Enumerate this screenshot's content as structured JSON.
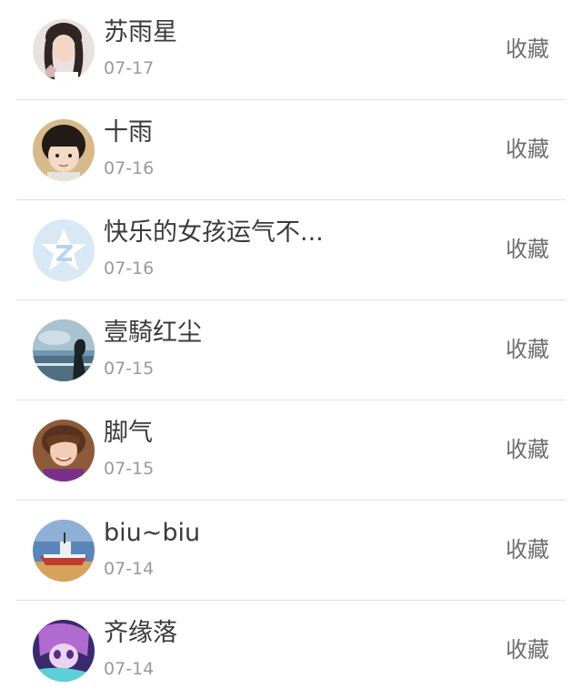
{
  "items": [
    {
      "name": "苏雨星",
      "date": "07-17",
      "action": "收藏",
      "avatar_icon": "girl-portrait-avatar",
      "avatar_colors": [
        "#e9e1df",
        "#2f2523",
        "#f3d6c8"
      ]
    },
    {
      "name": "十雨",
      "date": "07-16",
      "action": "收藏",
      "avatar_icon": "child-portrait-avatar",
      "avatar_colors": [
        "#d7b98c",
        "#231b16",
        "#f4d9c6"
      ]
    },
    {
      "name": "快乐的女孩运气不...",
      "date": "07-16",
      "action": "收藏",
      "avatar_icon": "qzone-default-avatar",
      "avatar_colors": [
        "#d8e9f5",
        "#ffffff",
        "#b8d4ea"
      ]
    },
    {
      "name": "壹騎红尘",
      "date": "07-15",
      "action": "收藏",
      "avatar_icon": "silhouette-sea-avatar",
      "avatar_colors": [
        "#6f97b2",
        "#1b2328",
        "#a9c2cf"
      ]
    },
    {
      "name": "脚气",
      "date": "07-15",
      "action": "收藏",
      "avatar_icon": "boy-portrait-avatar",
      "avatar_colors": [
        "#8d5a3a",
        "#f3cdb5",
        "#7b2f8a"
      ]
    },
    {
      "name": "biu~biu",
      "date": "07-14",
      "action": "收藏",
      "avatar_icon": "boat-beach-avatar",
      "avatar_colors": [
        "#5b86b8",
        "#c33a2e",
        "#d8a25a"
      ]
    },
    {
      "name": "齐缘落",
      "date": "07-14",
      "action": "收藏",
      "avatar_icon": "anime-character-avatar",
      "avatar_colors": [
        "#3b2a6e",
        "#b06ad0",
        "#5bd0d8"
      ]
    }
  ]
}
